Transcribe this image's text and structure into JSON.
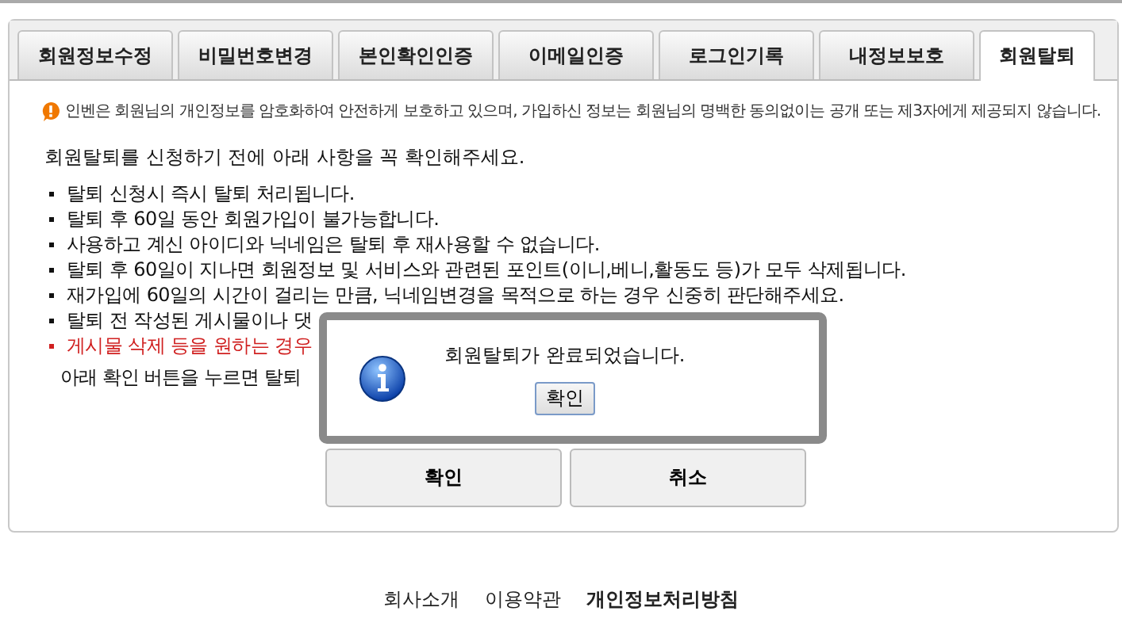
{
  "tabs": [
    {
      "label": "회원정보수정",
      "selected": false
    },
    {
      "label": "비밀번호변경",
      "selected": false
    },
    {
      "label": "본인확인인증",
      "selected": false
    },
    {
      "label": "이메일인증",
      "selected": false
    },
    {
      "label": "로그인기록",
      "selected": false
    },
    {
      "label": "내정보보호",
      "selected": false
    },
    {
      "label": "회원탈퇴",
      "selected": true
    }
  ],
  "notice": "인벤은 회원님의 개인정보를 암호화하여 안전하게 보호하고 있으며, 가입하신 정보는 회원님의 명백한 동의없이는 공개 또는 제3자에게 제공되지 않습니다.",
  "intro": "회원탈퇴를 신청하기 전에 아래 사항을 꼭 확인해주세요.",
  "rules": [
    {
      "text": "탈퇴 신청시 즉시 탈퇴 처리됩니다.",
      "kind": "normal"
    },
    {
      "text": "탈퇴 후 60일 동안 회원가입이 불가능합니다.",
      "kind": "normal"
    },
    {
      "text": "사용하고 계신 아이디와 닉네임은 탈퇴 후 재사용할 수 없습니다.",
      "kind": "normal"
    },
    {
      "text": "탈퇴 후 60일이 지나면 회원정보 및 서비스와 관련된 포인트(이니,베니,활동도 등)가 모두 삭제됩니다.",
      "kind": "normal"
    },
    {
      "text": "재가입에 60일의 시간이 걸리는 만큼, 닉네임변경을 목적으로 하는 경우 신중히 판단해주세요.",
      "kind": "normal"
    },
    {
      "text": "탈퇴 전 작성된 게시물이나 댓",
      "kind": "normal"
    },
    {
      "text": "게시물 삭제 등을 원하는 경우",
      "kind": "warning"
    }
  ],
  "confirm_note": "아래 확인 버튼을 누르면 탈퇴",
  "buttons": [
    "확인",
    "취소"
  ],
  "dialog": {
    "message": "회원탈퇴가 완료되었습니다.",
    "button": "확인"
  },
  "footer_links": [
    {
      "label": "회사소개",
      "emphasized": false
    },
    {
      "label": "이용약관",
      "emphasized": false
    },
    {
      "label": "개인정보처리방침",
      "emphasized": true
    }
  ]
}
